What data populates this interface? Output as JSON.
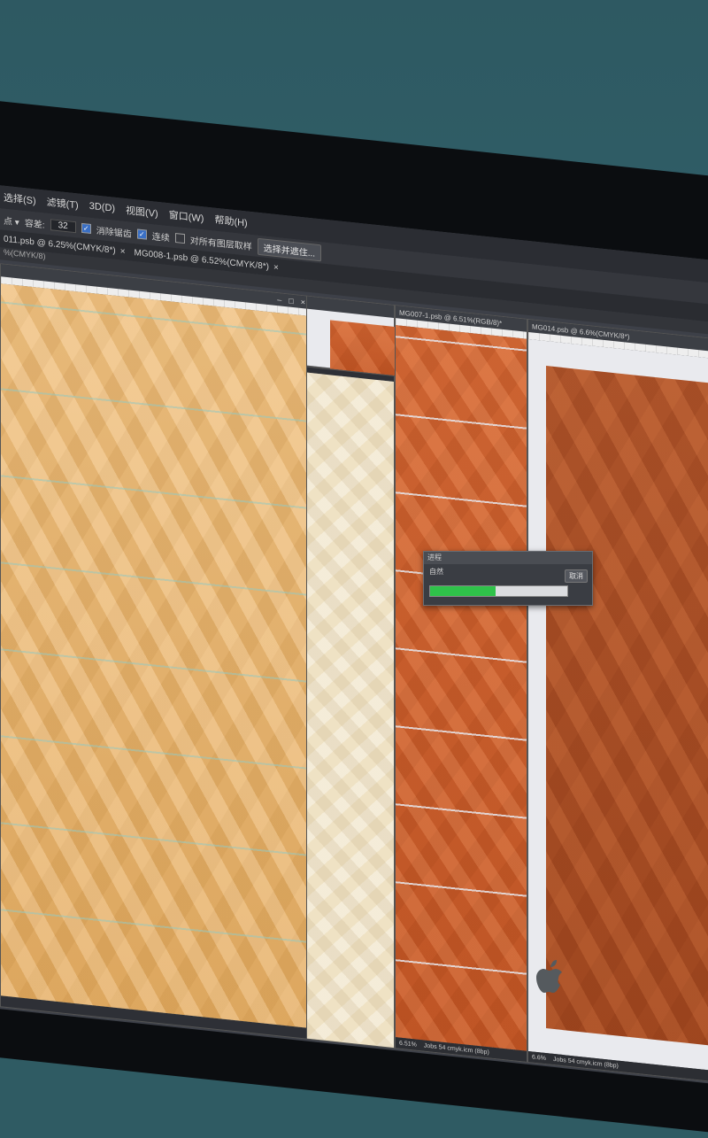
{
  "menu": {
    "items": [
      "选择(S)",
      "滤镜(T)",
      "3D(D)",
      "视图(V)",
      "窗口(W)",
      "帮助(H)"
    ]
  },
  "options": {
    "point_label": "点",
    "tolerance_label": "容差:",
    "tolerance_value": "32",
    "antialias_label": "消除锯齿",
    "contiguous_label": "连续",
    "sample_all_label": "对所有图层取样",
    "select_subject_label": "选择并遮住..."
  },
  "tabs": [
    {
      "label": "011.psb @ 6.25%(CMYK/8*)",
      "close": "×"
    },
    {
      "label": "MG008-1.psb @ 6.52%(CMYK/8*)",
      "close": "×"
    }
  ],
  "breadcrumb": "%(CMYK/8)",
  "windows": {
    "left_controls": [
      "–",
      "□",
      "×"
    ],
    "mg007_title": "MG007-1.psb @ 6.51%(RGB/8)*",
    "mg014_title": "MG014.psb @ 6.6%(CMYK/8*)",
    "mg007_zoom": "6.51%",
    "mg007_status": "Jobs 54 cmyk.icm (8bp)",
    "mg014_zoom": "6.6%",
    "mg014_status": "Jobs 54 cmyk.icm (8bp)"
  },
  "dialog": {
    "title": "进程",
    "label": "自然",
    "cancel_label": "取消",
    "progress": 0.48
  },
  "colors": {
    "progress_fill": "#2fc24a",
    "light_wood": "#e9b46c",
    "orange_wood": "#cf6230",
    "brown_wood": "#ad5126"
  },
  "icons": {
    "brand": "apple-logo-icon"
  }
}
